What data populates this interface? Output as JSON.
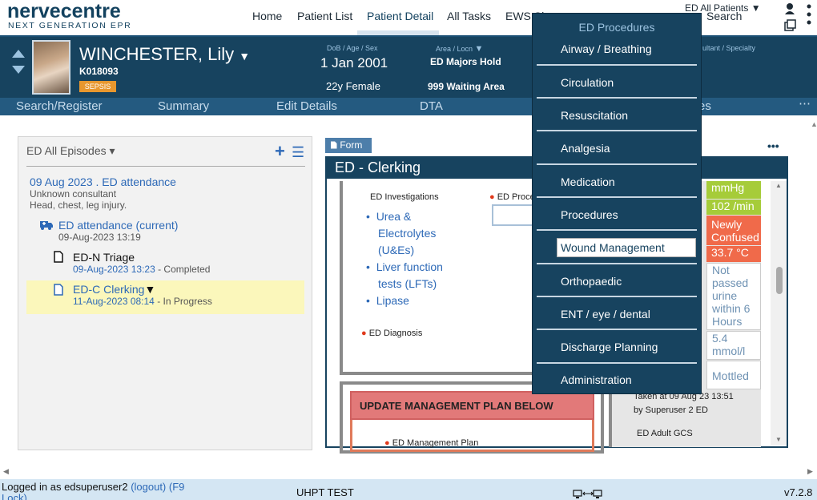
{
  "app": {
    "logo_main": "nervecentre",
    "logo_sub": "NEXT GENERATION EPR",
    "nav": [
      "Home",
      "Patient List",
      "Patient Detail",
      "All Tasks",
      "EWS Sh"
    ],
    "patients_filter": "ED All Patients ▼",
    "search_label": "Search"
  },
  "patient": {
    "name": "WINCHESTER, Lily",
    "name_caret": "▼",
    "mrn": "K018093",
    "badge": "SEPSIS",
    "dob_head": "DoB / Age / Sex",
    "dob": "1 Jan 2001",
    "age_sex": "22y Female",
    "area_head": "Area / Locn",
    "area": "ED Majors Hold",
    "locn": "999 Waiting Area",
    "consultant_head": "ultant / Specialty"
  },
  "subnav": [
    "Search/Register",
    "Summary",
    "Edit Details",
    "DTA",
    "es",
    "⋯"
  ],
  "episodes": {
    "header": "ED All Episodes ▾",
    "add_icon": "+",
    "menu_icon": "☰",
    "attendance_title": "09 Aug 2023 . ED attendance",
    "consultant": "Unknown consultant",
    "complaint": "Head, chest, leg injury.",
    "current": "ED attendance (current)",
    "current_time": "09-Aug-2023 13:19",
    "triage": "ED-N Triage",
    "triage_time": "09-Aug-2023 13:23",
    "triage_status": " - Completed",
    "clerking": "ED-C Clerking",
    "clerking_caret": "▼",
    "clerking_time": "11-Aug-2023 08:14",
    "clerking_status": " - In Progress"
  },
  "form": {
    "tab": "Form",
    "title": "ED - Clerking",
    "more": "•••",
    "investigations_label": "ED Investigations",
    "procedures_label": "ED Proce",
    "investigations": [
      "Urea &",
      "Electrolytes",
      "(U&Es)",
      "Liver function",
      "tests (LFTs)",
      "Lipase"
    ],
    "diagnosis_label": "ED Diagnosis",
    "mgmt_banner": "UPDATE MANAGEMENT PLAN BELOW",
    "mgmt_label": "ED Management Plan",
    "taken": "Taken at 09 Aug 23 13:51",
    "taken_by": "by Superuser 2 ED",
    "gcs": "ED Adult GCS"
  },
  "vitals": {
    "bp_unit": "mmHg",
    "pulse": "102 /min",
    "conf1": "Newly",
    "conf2": "Confused",
    "temp": "33.7 °C",
    "urine": [
      "Not",
      "passed",
      "urine",
      "within 6",
      "Hours"
    ],
    "lactate1": "5.4",
    "lactate2": "mmol/l",
    "skin": "Mottled"
  },
  "dropdown": {
    "title": "ED Procedures",
    "items": [
      "Airway / Breathing",
      "Circulation",
      "Resuscitation",
      "Analgesia",
      "Medication",
      "Procedures",
      "Wound Management",
      "Orthopaedic",
      "ENT / eye / dental",
      "Discharge Planning",
      "Administration"
    ]
  },
  "status": {
    "logged_in": "Logged in as edsuperuser2",
    "logout": "(logout)",
    "lock": "(F9",
    "lock2": "Lock)",
    "env": "UHPT TEST",
    "version": "v7.2.8"
  },
  "colors": {
    "banner": "#17435f",
    "accent": "#2d69b7",
    "sepsis": "#e8972e",
    "green": "#a6cc39",
    "red": "#f06a4a"
  }
}
